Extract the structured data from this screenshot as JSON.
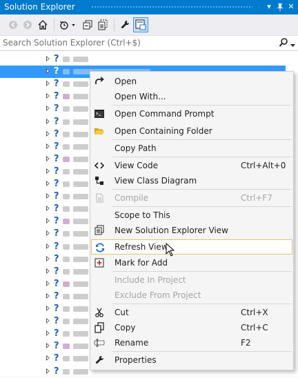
{
  "window": {
    "title": "Solution Explorer",
    "pin_glyph": "▾",
    "autohide_glyph": "ᵒ",
    "close_glyph": "✕"
  },
  "toolbar": {
    "buttons": [
      "back-icon",
      "forward-icon",
      "home-icon",
      "history-icon",
      "collapse-all-icon",
      "show-all-files-icon",
      "properties-wrench-icon",
      "preview-selected-icon"
    ]
  },
  "search": {
    "placeholder": "Search Solution Explorer (Ctrl+$)"
  },
  "tree": {
    "expander_glyph": "▷",
    "unknown_glyph": "?"
  },
  "menu": {
    "items": [
      {
        "label": "Open",
        "shortcut": "",
        "icon": "open-arrow-icon",
        "disabled": false
      },
      {
        "label": "Open With...",
        "shortcut": "",
        "icon": "",
        "disabled": false
      },
      {
        "label": "Open Command Prompt",
        "shortcut": "",
        "icon": "command-prompt-icon",
        "disabled": false
      },
      {
        "label": "Open Containing Folder",
        "shortcut": "",
        "icon": "folder-icon",
        "disabled": false
      },
      {
        "label": "Copy Path",
        "shortcut": "",
        "icon": "",
        "disabled": false
      },
      {
        "label": "View Code",
        "shortcut": "Ctrl+Alt+0",
        "icon": "view-code-icon",
        "disabled": false
      },
      {
        "label": "View Class Diagram",
        "shortcut": "",
        "icon": "class-diagram-icon",
        "disabled": false
      },
      {
        "label": "Compile",
        "shortcut": "Ctrl+F7",
        "icon": "compile-icon",
        "disabled": true
      },
      {
        "label": "Scope to This",
        "shortcut": "",
        "icon": "",
        "disabled": false
      },
      {
        "label": "New Solution Explorer View",
        "shortcut": "",
        "icon": "new-view-icon",
        "disabled": false
      },
      {
        "label": "Refresh View",
        "shortcut": "",
        "icon": "refresh-icon",
        "disabled": false
      },
      {
        "label": "Mark for Add",
        "shortcut": "",
        "icon": "mark-for-add-icon",
        "disabled": false
      },
      {
        "label": "Include In Project",
        "shortcut": "",
        "icon": "",
        "disabled": true
      },
      {
        "label": "Exclude From Project",
        "shortcut": "",
        "icon": "",
        "disabled": true
      },
      {
        "label": "Cut",
        "shortcut": "Ctrl+X",
        "icon": "scissors-icon",
        "disabled": false
      },
      {
        "label": "Copy",
        "shortcut": "Ctrl+C",
        "icon": "copy-icon",
        "disabled": false
      },
      {
        "label": "Rename",
        "shortcut": "F2",
        "icon": "rename-icon",
        "disabled": false
      },
      {
        "label": "Properties",
        "shortcut": "",
        "icon": "wrench-icon",
        "disabled": false
      }
    ],
    "hovered": "Refresh View"
  },
  "colors": {
    "accent": "#007acc",
    "selection": "#3399ff",
    "hover_border": "#e5c365"
  }
}
